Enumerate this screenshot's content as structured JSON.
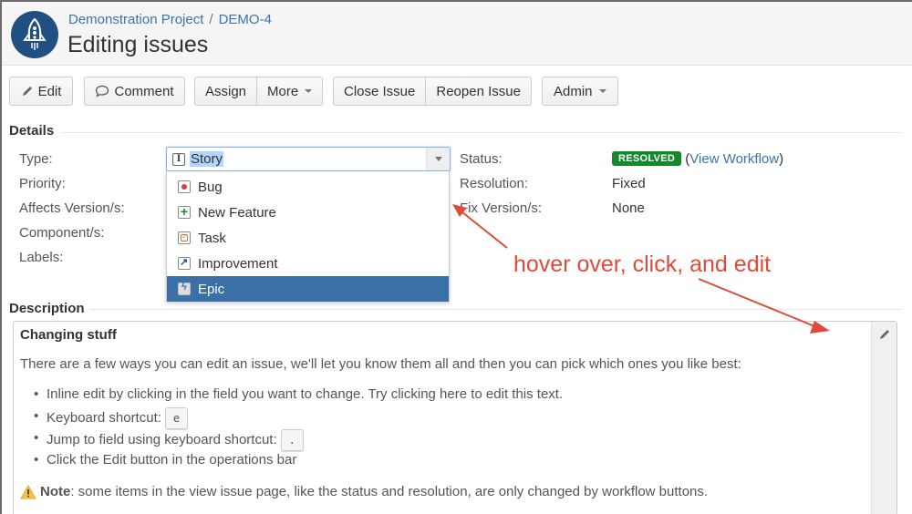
{
  "header": {
    "breadcrumb": {
      "project": "Demonstration Project",
      "separator": "/",
      "issue_key": "DEMO-4"
    },
    "title": "Editing issues",
    "avatar_icon": "rocket-icon"
  },
  "toolbar": {
    "edit": "Edit",
    "comment": "Comment",
    "assign": "Assign",
    "more": "More",
    "close_issue": "Close Issue",
    "reopen_issue": "Reopen Issue",
    "admin": "Admin"
  },
  "details": {
    "heading": "Details",
    "left": [
      {
        "label": "Type:",
        "value": "Story"
      },
      {
        "label": "Priority:",
        "value": ""
      },
      {
        "label": "Affects Version/s:",
        "value": ""
      },
      {
        "label": "Component/s:",
        "value": ""
      },
      {
        "label": "Labels:",
        "value": ""
      }
    ],
    "right": [
      {
        "label": "Status:",
        "badge": "RESOLVED",
        "link": "View Workflow"
      },
      {
        "label": "Resolution:",
        "value": "Fixed"
      },
      {
        "label": "Fix Version/s:",
        "value": "None"
      }
    ],
    "status_color": "#14892c"
  },
  "type_dropdown": {
    "selected": "Story",
    "options": [
      {
        "label": "Bug",
        "icon": "bug-icon"
      },
      {
        "label": "New Feature",
        "icon": "new-feature-icon"
      },
      {
        "label": "Task",
        "icon": "task-icon"
      },
      {
        "label": "Improvement",
        "icon": "improvement-icon"
      },
      {
        "label": "Epic",
        "icon": "epic-icon",
        "highlighted": true
      }
    ],
    "highlight_color": "#3b6fa8"
  },
  "annotation": {
    "text": "hover over, click, and edit",
    "color": "#e04a3a"
  },
  "description": {
    "heading": "Description",
    "title": "Changing stuff",
    "intro": "There are a few ways you can edit an issue, we'll let you know them all and then you can pick which ones you like best:",
    "items": [
      {
        "text": "Inline edit by clicking in the field you want to change. Try clicking here to edit this text."
      },
      {
        "text": "Keyboard shortcut:",
        "key": "e"
      },
      {
        "text": "Jump to field using keyboard shortcut:",
        "key": "."
      },
      {
        "text": "Click the Edit button in the operations bar"
      }
    ],
    "note_label": "Note",
    "note_text": ": some items in the view issue page, like the status and resolution, are only changed by workflow buttons."
  }
}
